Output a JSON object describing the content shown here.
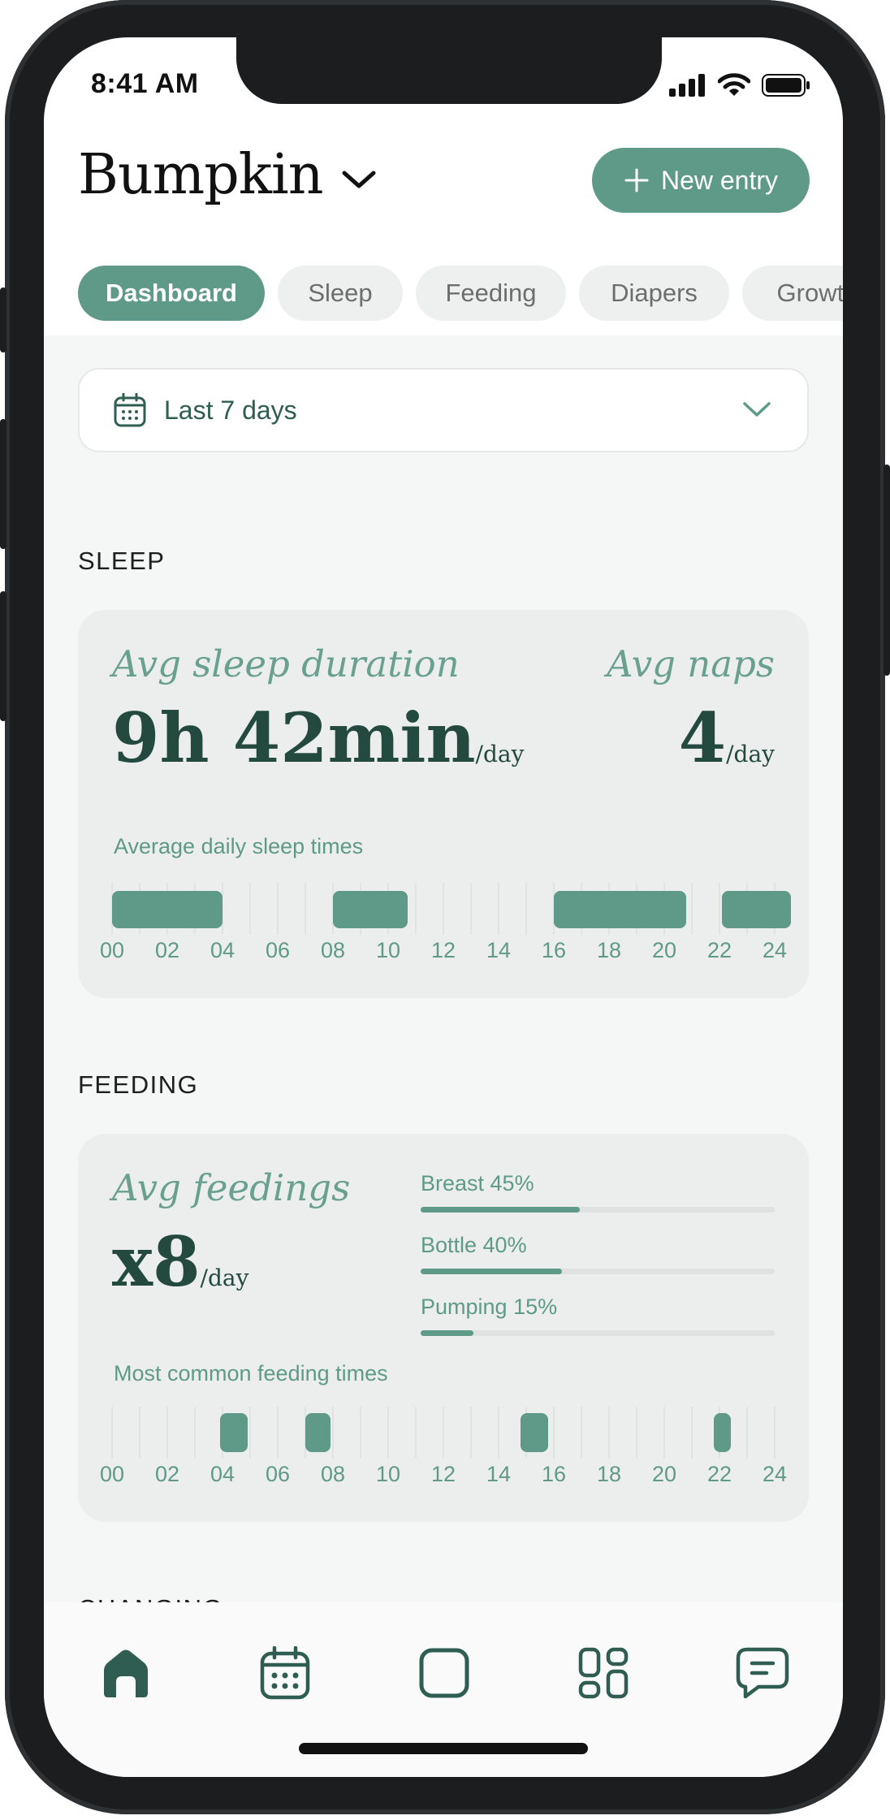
{
  "status_bar": {
    "time": "8:41 AM"
  },
  "header": {
    "title": "Bumpkin",
    "new_entry_label": "New entry"
  },
  "tabs": [
    {
      "label": "Dashboard",
      "active": true
    },
    {
      "label": "Sleep",
      "active": false
    },
    {
      "label": "Feeding",
      "active": false
    },
    {
      "label": "Diapers",
      "active": false
    },
    {
      "label": "Growth",
      "active": false
    }
  ],
  "date_range": {
    "label": "Last 7 days"
  },
  "sleep": {
    "section_title": "SLEEP",
    "avg_duration_label": "Avg sleep duration",
    "avg_duration_value": "9h 42min",
    "avg_duration_unit": "/day",
    "avg_naps_label": "Avg naps",
    "avg_naps_value": "4",
    "avg_naps_unit": "/day",
    "chart_title": "Average daily sleep times",
    "axis_labels": [
      "00",
      "02",
      "04",
      "06",
      "08",
      "10",
      "12",
      "14",
      "16",
      "18",
      "20",
      "22",
      "24"
    ],
    "sleep_blocks_hours": [
      [
        0,
        4
      ],
      [
        8,
        10.7
      ],
      [
        16,
        20.8
      ],
      [
        22.1,
        24.6
      ]
    ]
  },
  "feeding": {
    "section_title": "FEEDING",
    "avg_label": "Avg feedings",
    "avg_value": "x8",
    "avg_unit": "/day",
    "breakdown": [
      {
        "label": "Breast 45%",
        "percent": 45
      },
      {
        "label": "Bottle 40%",
        "percent": 40
      },
      {
        "label": "Pumping 15%",
        "percent": 15
      }
    ],
    "chart_title": "Most common feeding times",
    "axis_labels": [
      "00",
      "02",
      "04",
      "06",
      "08",
      "10",
      "12",
      "14",
      "16",
      "18",
      "20",
      "22",
      "24"
    ],
    "feeding_blocks_hours": [
      [
        3.9,
        4.9
      ],
      [
        7,
        7.9
      ],
      [
        14.8,
        15.8
      ],
      [
        21.8,
        22.4
      ]
    ]
  },
  "changing": {
    "section_title": "CHANGING"
  },
  "bottom_nav": [
    {
      "icon": "home-icon",
      "active": true
    },
    {
      "icon": "calendar-icon",
      "active": false
    },
    {
      "icon": "square-icon",
      "active": false
    },
    {
      "icon": "grid-icon",
      "active": false
    },
    {
      "icon": "chat-icon",
      "active": false
    }
  ],
  "colors": {
    "accent": "#5f9a88",
    "dark_green": "#244a40",
    "card_bg": "#ebeeec",
    "content_bg": "#f5f7f6"
  }
}
